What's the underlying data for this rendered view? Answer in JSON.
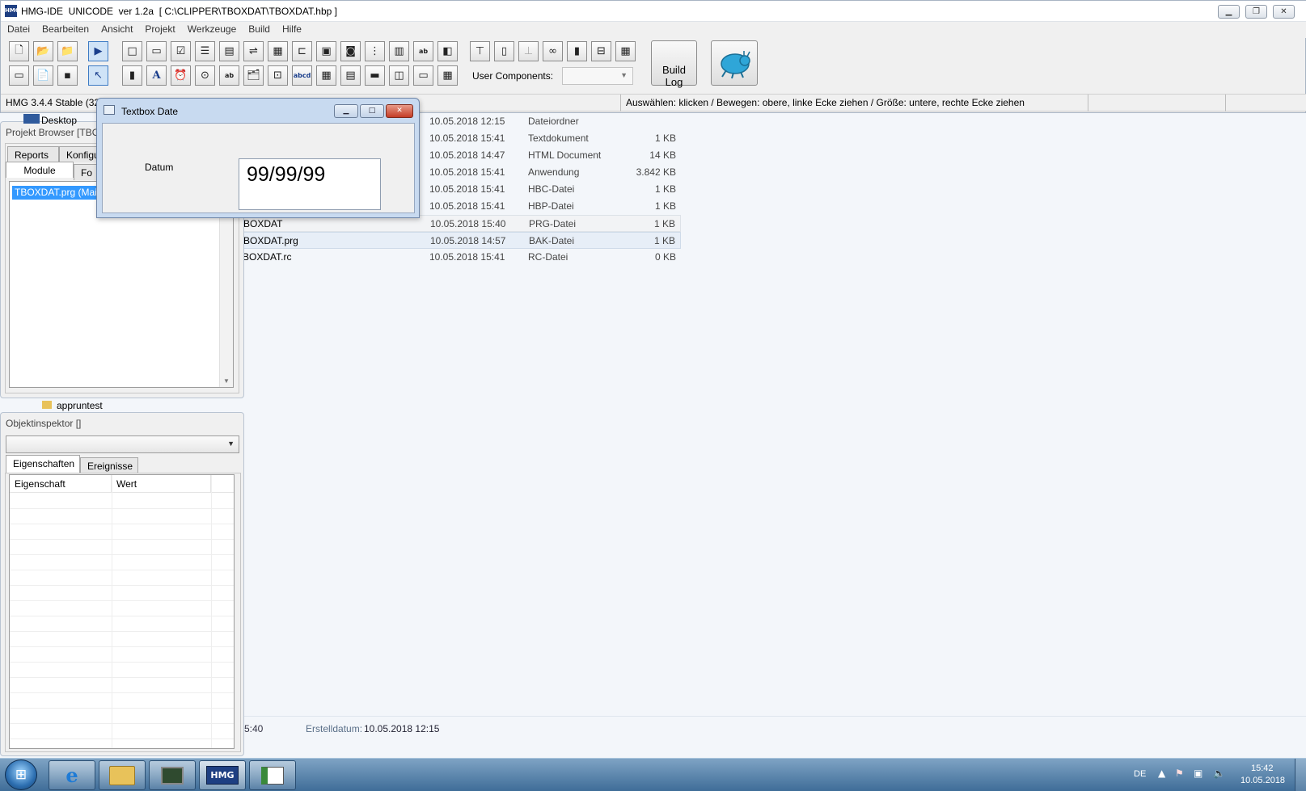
{
  "window": {
    "title": "HMG-IDE  UNICODE  ver 1.2a  [ C:\\CLIPPER\\TBOXDAT\\TBOXDAT.hbp ]",
    "icon_text": "HMG"
  },
  "menu": [
    "Datei",
    "Bearbeiten",
    "Ansicht",
    "Projekt",
    "Werkzeuge",
    "Build",
    "Hilfe"
  ],
  "toolbar": {
    "user_components_label": "User Components:",
    "user_components_value": "",
    "build_log_label": "Build\nLog"
  },
  "status": {
    "version": "HMG 3.4.4 Stable (32",
    "hint": "Auswählen: klicken / Bewegen: obere, linke Ecke ziehen / Größe: untere, rechte Ecke ziehen"
  },
  "explorer": {
    "rows": [
      {
        "name": "",
        "date": "10.05.2018 12:15",
        "type": "Dateiordner",
        "size": ""
      },
      {
        "name": "",
        "date": "10.05.2018 15:41",
        "type": "Textdokument",
        "size": "1 KB"
      },
      {
        "name": "",
        "date": "10.05.2018 14:47",
        "type": "HTML Document",
        "size": "14 KB"
      },
      {
        "name": "",
        "date": "10.05.2018 15:41",
        "type": "Anwendung",
        "size": "3.842 KB"
      },
      {
        "name": "",
        "date": "10.05.2018 15:41",
        "type": "HBC-Datei",
        "size": "1 KB"
      },
      {
        "name": "",
        "date": "10.05.2018 15:41",
        "type": "HBP-Datei",
        "size": "1 KB"
      },
      {
        "name": "BOXDAT",
        "date": "10.05.2018 15:40",
        "type": "PRG-Datei",
        "size": "1 KB"
      },
      {
        "name": "BOXDAT.prg",
        "date": "10.05.2018 14:57",
        "type": "BAK-Datei",
        "size": "1 KB"
      },
      {
        "name": "BOXDAT.rc",
        "date": "10.05.2018 15:41",
        "type": "RC-Datei",
        "size": "0 KB"
      }
    ],
    "details_time": "5:40",
    "details_created_label": "Erstelldatum:",
    "details_created_value": "10.05.2018 12:15",
    "behind_item_1": "Desktop",
    "behind_item_2": "appruntest"
  },
  "project_browser": {
    "title": "Projekt Browser [TBO",
    "tabs_row1": [
      "Reports",
      "Konfigu"
    ],
    "tabs_row2": [
      "Module",
      "Fo"
    ],
    "module_item": "TBOXDAT.prg (Main"
  },
  "object_inspector": {
    "title": "Objektinspektor []",
    "select_value": "",
    "tabs": [
      "Eigenschaften",
      "Ereignisse"
    ],
    "columns": [
      "Eigenschaft",
      "Wert"
    ]
  },
  "form_window": {
    "title": "Textbox Date",
    "label": "Datum",
    "textbox_value": "99/99/99"
  },
  "taskbar": {
    "language": "DE",
    "time": "15:42",
    "date": "10.05.2018",
    "hmg_label": "HMG"
  }
}
